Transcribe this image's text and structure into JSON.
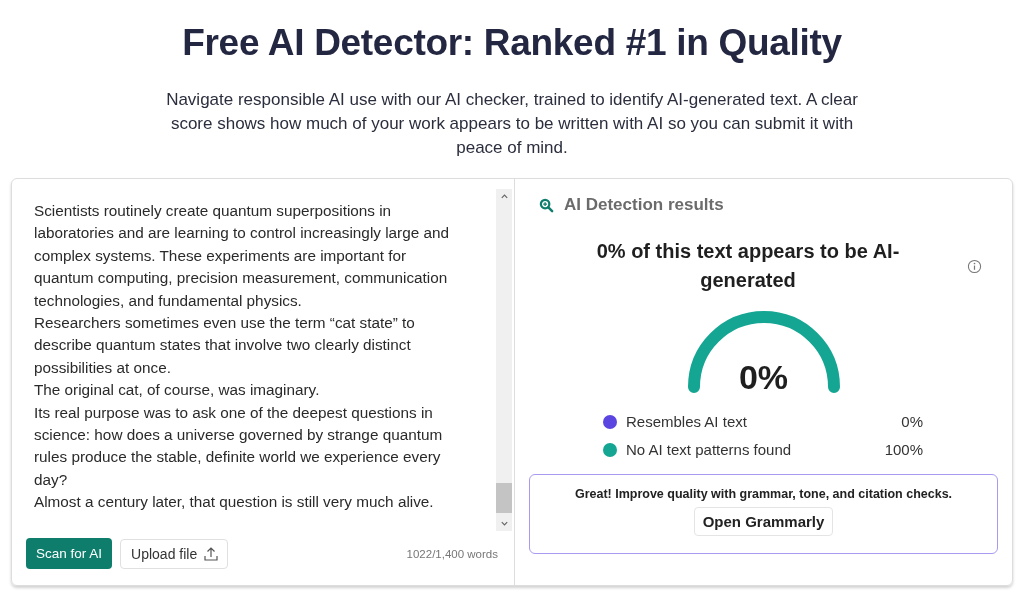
{
  "heading": {
    "title": "Free AI Detector: Ranked #1 in Quality",
    "subtitle": "Navigate responsible AI use with our AI checker, trained to identify AI-generated text. A clear score shows how much of your work appears to be written with AI so you can submit it with peace of mind."
  },
  "editor": {
    "paragraphs": [
      "Scientists routinely create quantum superpositions in laboratories and are learning to control increasingly large and complex systems. These experiments are important for quantum computing, precision measurement, communication technologies, and fundamental physics.",
      "Researchers sometimes even use the term “cat state” to describe quantum states that involve two clearly distinct possibilities at once.",
      "The original cat, of course, was imaginary.",
      "Its real purpose was to ask one of the deepest questions in science: how does a universe governed by strange quantum rules produce the stable, definite world we experience every day?",
      "Almost a century later, that question is still very much alive."
    ],
    "scan_button": "Scan for AI",
    "upload_button": "Upload file",
    "word_count": "1022/1,400 words"
  },
  "results": {
    "title": "AI Detection results",
    "headline": "0% of this text appears to be AI-generated",
    "gauge": {
      "reading": "0%"
    },
    "legend": [
      {
        "label": "Resembles AI text",
        "value": "0%",
        "color": "#5b45e0"
      },
      {
        "label": "No AI text patterns found",
        "value": "100%",
        "color": "#14a693"
      }
    ],
    "promo": {
      "text": "Great! Improve quality with grammar, tone, and citation checks.",
      "button": "Open Grammarly"
    }
  }
}
